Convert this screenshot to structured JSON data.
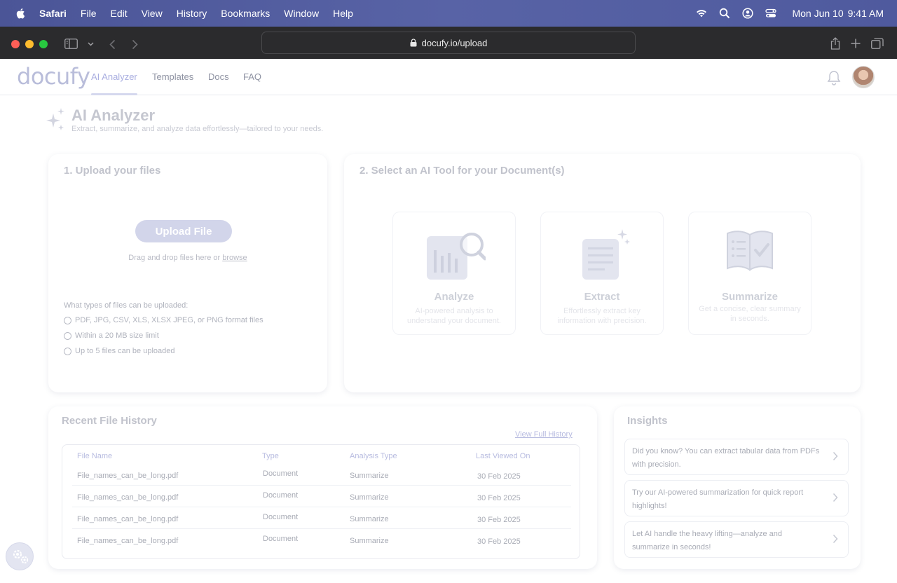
{
  "menubar": {
    "app": "Safari",
    "items": [
      "File",
      "Edit",
      "View",
      "History",
      "Bookmarks",
      "Window",
      "Help"
    ],
    "date": "Mon Jun 10",
    "time": "9:41 AM",
    "icons": [
      "apple-icon",
      "wifi-icon",
      "search-icon",
      "user-icon",
      "control-center-icon"
    ]
  },
  "browser": {
    "url": "docufy.io/upload"
  },
  "nav": {
    "logo": "docufy",
    "tabs": [
      "AI Analyzer",
      "Templates",
      "Docs",
      "FAQ"
    ],
    "active_tab": "AI Analyzer"
  },
  "header": {
    "title": "AI Analyzer",
    "subtitle": "Extract, summarize, and analyze data effortlessly—tailored to your needs."
  },
  "upload": {
    "title": "1. Upload your files",
    "button": "Upload File",
    "drag_text": "Drag and drop files here or ",
    "browse": "browse",
    "types_question": "What types of files can be uploaded:",
    "types": [
      "PDF, JPG, CSV, XLS, XLSX JPEG, or PNG format files",
      "Within a 20 MB size limit",
      "Up to 5 files can be uploaded"
    ]
  },
  "tools": {
    "title": "2. Select an AI Tool for your Document(s)",
    "items": [
      {
        "name": "Analyze",
        "desc": "AI-powered analysis to understand your document."
      },
      {
        "name": "Extract",
        "desc": "Effortlessly extract key information with precision."
      },
      {
        "name": "Summarize",
        "desc": "Get a concise, clear summary in seconds."
      }
    ]
  },
  "history": {
    "title": "Recent File History",
    "view_full": "View Full History",
    "columns": [
      "File Name",
      "Type",
      "Analysis Type",
      "Last Viewed On"
    ],
    "rows": [
      [
        "File_names_can_be_long.pdf",
        "Document",
        "Summarize",
        "30 Feb 2025"
      ],
      [
        "File_names_can_be_long.pdf",
        "Document",
        "Summarize",
        "30 Feb 2025"
      ],
      [
        "File_names_can_be_long.pdf",
        "Document",
        "Summarize",
        "30 Feb 2025"
      ],
      [
        "File_names_can_be_long.pdf",
        "Document",
        "Summarize",
        "30 Feb 2025"
      ]
    ]
  },
  "insights": {
    "title": "Insights",
    "items": [
      "Did you know? You can extract tabular data from PDFs with precision.",
      "Try our AI-powered summarization for quick report highlights!",
      "Let AI handle the heavy lifting—analyze and summarize in seconds!"
    ]
  },
  "colors": {
    "menubar": "#5560a2",
    "accent": "#a9aee0",
    "toolbar": "#2b2b2d"
  }
}
